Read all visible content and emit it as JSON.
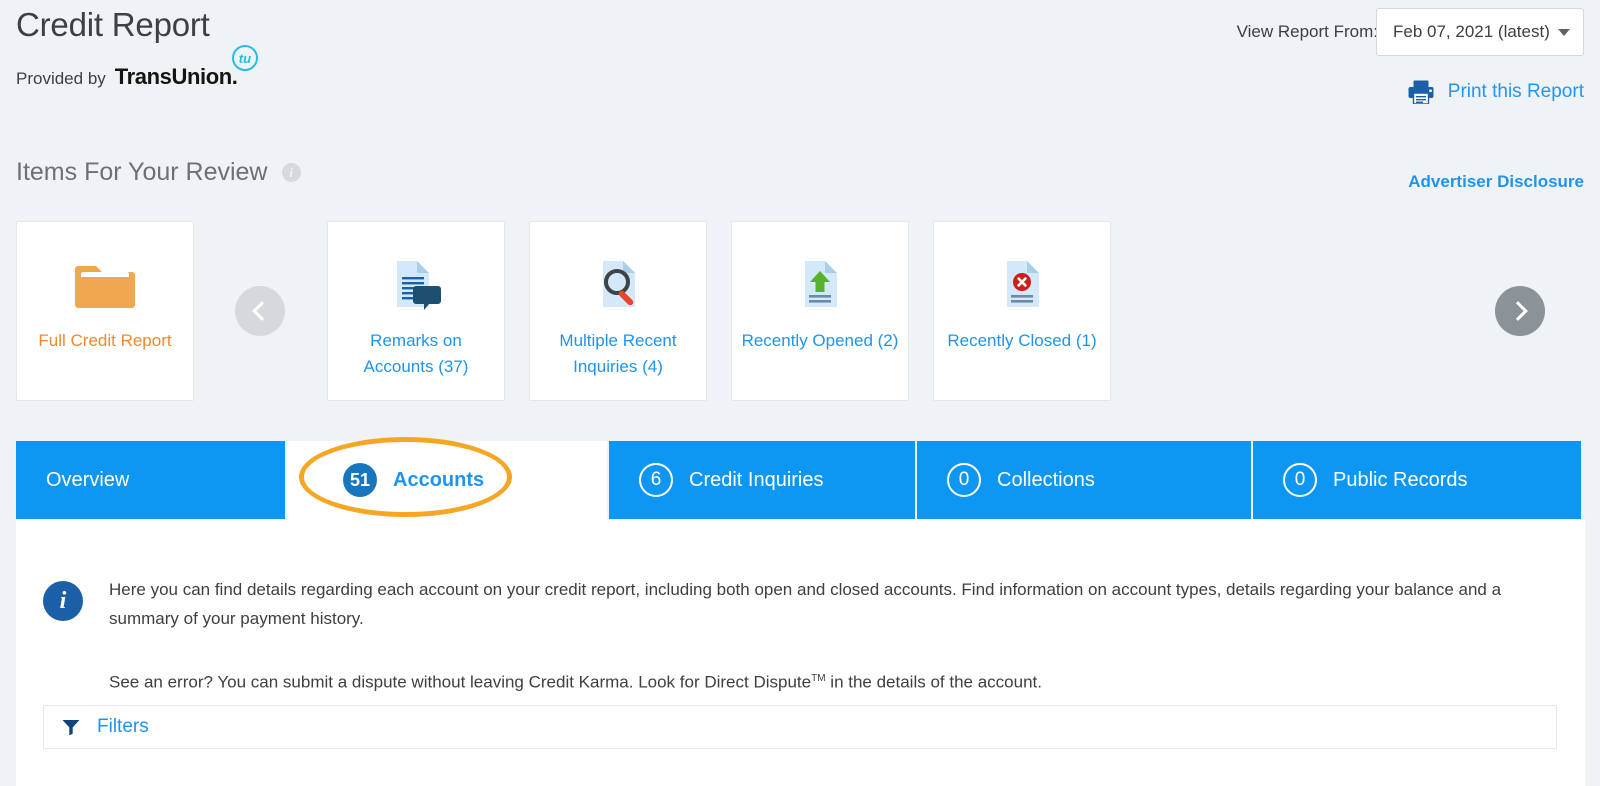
{
  "header": {
    "title": "Credit Report",
    "provided_by": "Provided by",
    "bureau": "TransUnion",
    "bureau_dot": ".",
    "bureau_badge": "tu",
    "view_report_from_label": "View Report From:",
    "selected_date": "Feb 07, 2021 (latest)",
    "print_label": "Print this Report",
    "printer_icon": "printer-icon",
    "caret_icon": "chevron-down-icon"
  },
  "review": {
    "title": "Items For Your Review",
    "info_icon": "info-icon",
    "info_glyph": "i",
    "advertiser_disclosure": "Advertiser Disclosure",
    "prev_arrow": "chevron-left-icon",
    "next_arrow": "chevron-right-icon",
    "cards": [
      {
        "label": "Full Credit Report",
        "icon": "folder-icon",
        "accent": "#f2882d"
      },
      {
        "label": "Remarks on Accounts (37)",
        "icon": "document-comment-icon",
        "accent": "#1e94f0"
      },
      {
        "label": "Multiple Recent Inquiries (4)",
        "icon": "document-magnifier-icon",
        "accent": "#1e94f0"
      },
      {
        "label": "Recently Opened (2)",
        "icon": "document-up-arrow-icon",
        "accent": "#1e94f0"
      },
      {
        "label": "Recently Closed (1)",
        "icon": "document-error-icon",
        "accent": "#1e94f0"
      }
    ]
  },
  "tabs": [
    {
      "label": "Overview",
      "count": null,
      "active": false
    },
    {
      "label": "Accounts",
      "count": "51",
      "active": true
    },
    {
      "label": "Credit Inquiries",
      "count": "6",
      "active": false
    },
    {
      "label": "Collections",
      "count": "0",
      "active": false
    },
    {
      "label": "Public Records",
      "count": "0",
      "active": false
    }
  ],
  "panel": {
    "info_icon": "info-icon",
    "info_glyph": "i",
    "paragraph1": "Here you can find details regarding each account on your credit report, including both open and closed accounts. Find information on account types, details regarding your balance and a summary of your payment history.",
    "paragraph2_pre": "See an error? You can submit a dispute without leaving Credit Karma. Look for Direct Dispute",
    "paragraph2_tm": "TM",
    "paragraph2_post": " in the details of the account.",
    "filters_label": "Filters",
    "filters_icon": "filter-funnel-icon"
  },
  "colors": {
    "page_bg": "#f0f3f5",
    "tab_blue": "#0d96f2",
    "link_blue": "#1e94f0",
    "accent_orange": "#f2882d",
    "annotation_orange": "#f5a623",
    "badge_blue": "#1776bd",
    "info_blue": "#1b5fa8"
  }
}
